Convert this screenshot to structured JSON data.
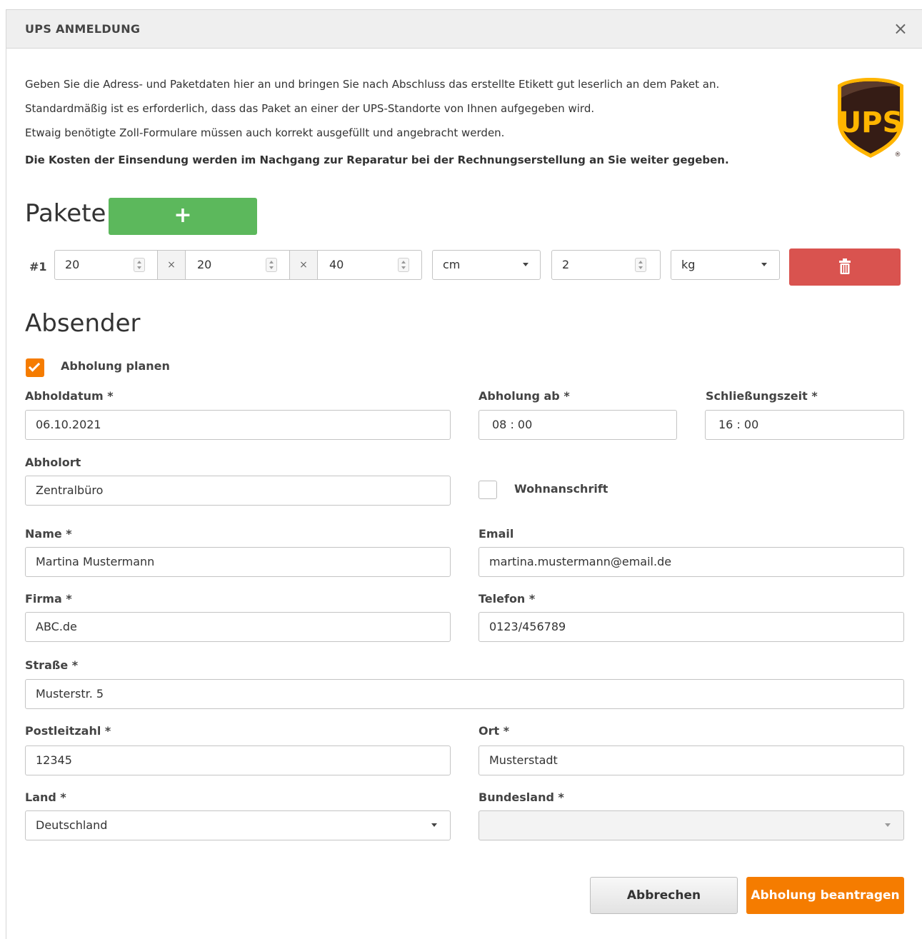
{
  "dialog": {
    "title": "UPS ANMELDUNG",
    "close_icon": "×"
  },
  "intro": {
    "line1": "Geben Sie die Adress- und Paketdaten hier an und bringen Sie nach Abschluss das erstellte Etikett gut leserlich an dem Paket an.",
    "line2": "Standardmäßig ist es erforderlich, dass das Paket an einer der UPS-Standorte von Ihnen aufgegeben wird.",
    "line3": "Etwaig benötigte Zoll-Formulare müssen auch korrekt ausgefüllt und angebracht werden.",
    "line4_bold": "Die Kosten der Einsendung werden im Nachgang zur Reparatur bei der Rechnungserstellung an Sie weiter gegeben."
  },
  "logo": {
    "text": "UPS",
    "registered": "®",
    "colors": {
      "shield": "#351c15",
      "gold": "#ffb500"
    }
  },
  "pakete": {
    "title": "Pakete",
    "add_label": "+",
    "items": [
      {
        "number": "#1",
        "length": "20",
        "width": "20",
        "height": "40",
        "times": "×",
        "unit_dimension": "cm",
        "weight": "2",
        "unit_weight": "kg"
      }
    ]
  },
  "absender": {
    "title": "Absender",
    "pickup_checkbox_label": "Abholung planen",
    "pickup_checked": true,
    "abholdatum_label": "Abholdatum *",
    "abholdatum_value": "06.10.2021",
    "abholung_ab_label": "Abholung ab *",
    "abholung_ab_value": "08 : 00",
    "schliessungszeit_label": "Schließungszeit *",
    "schliessungszeit_value": "16 : 00",
    "abholort_label": "Abholort",
    "abholort_value": "Zentralbüro",
    "wohnanschrift_label": "Wohnanschrift",
    "wohnanschrift_checked": false,
    "name_label": "Name *",
    "name_value": "Martina Mustermann",
    "email_label": "Email",
    "email_value": "martina.mustermann@email.de",
    "firma_label": "Firma *",
    "firma_value": "ABC.de",
    "telefon_label": "Telefon *",
    "telefon_value": "0123/456789",
    "strasse_label": "Straße *",
    "strasse_value": "Musterstr. 5",
    "plz_label": "Postleitzahl *",
    "plz_value": "12345",
    "ort_label": "Ort *",
    "ort_value": "Musterstadt",
    "land_label": "Land *",
    "land_value": "Deutschland",
    "bundesland_label": "Bundesland *",
    "bundesland_value": ""
  },
  "actions": {
    "cancel_label": "Abbrechen",
    "submit_label": "Abholung beantragen"
  },
  "colors": {
    "add_button": "#5cb85c",
    "delete_button": "#d9534f",
    "accent_orange": "#f57c00"
  }
}
